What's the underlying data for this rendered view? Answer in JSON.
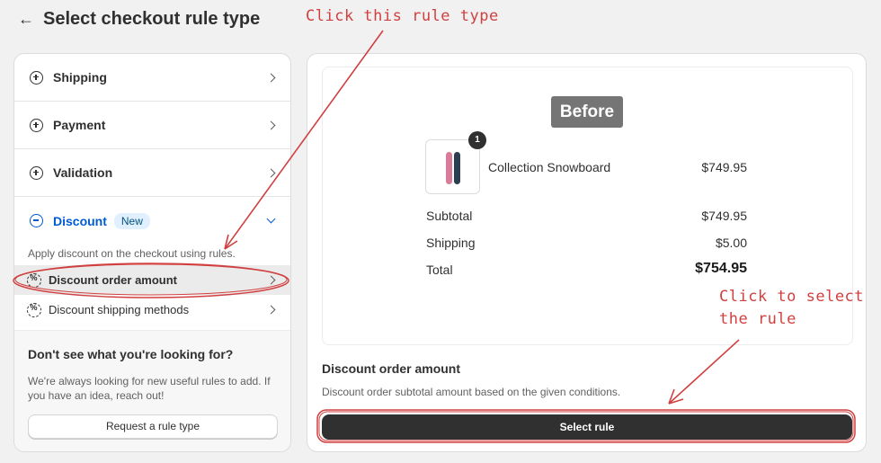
{
  "header": {
    "back_icon": "arrow-left-icon",
    "title": "Select checkout rule type"
  },
  "categories": [
    {
      "label": "Shipping",
      "icon": "circle-plus-icon"
    },
    {
      "label": "Payment",
      "icon": "circle-plus-icon"
    },
    {
      "label": "Validation",
      "icon": "circle-plus-icon"
    }
  ],
  "discount": {
    "label": "Discount",
    "badge": "New",
    "icon": "circle-minus-icon",
    "description": "Apply discount on the checkout using rules.",
    "rules": [
      {
        "label": "Discount order amount",
        "icon": "discount-gear-icon",
        "selected": true
      },
      {
        "label": "Discount shipping methods",
        "icon": "discount-gear-icon",
        "selected": false
      }
    ]
  },
  "help": {
    "title": "Don't see what you're looking for?",
    "text": "We're always looking for new useful rules to add. If you have an idea, reach out!",
    "button": "Request a rule type"
  },
  "preview": {
    "tag": "Before",
    "item": {
      "name": "Collection Snowboard",
      "price": "$749.95",
      "quantity": "1"
    },
    "subtotal_label": "Subtotal",
    "subtotal_value": "$749.95",
    "shipping_label": "Shipping",
    "shipping_value": "$5.00",
    "total_label": "Total",
    "total_value": "$754.95"
  },
  "selected_rule": {
    "title": "Discount order amount",
    "description": "Discount order subtotal amount based on the given conditions.",
    "button": "Select rule"
  },
  "annotations": {
    "top": "Click this rule type",
    "bottom_line1": "Click to select",
    "bottom_line2": "the rule",
    "color": "#d14040"
  },
  "colors": {
    "accent": "#005bd3",
    "badge_bg": "#e0f0ff",
    "button_dark": "#303030"
  }
}
